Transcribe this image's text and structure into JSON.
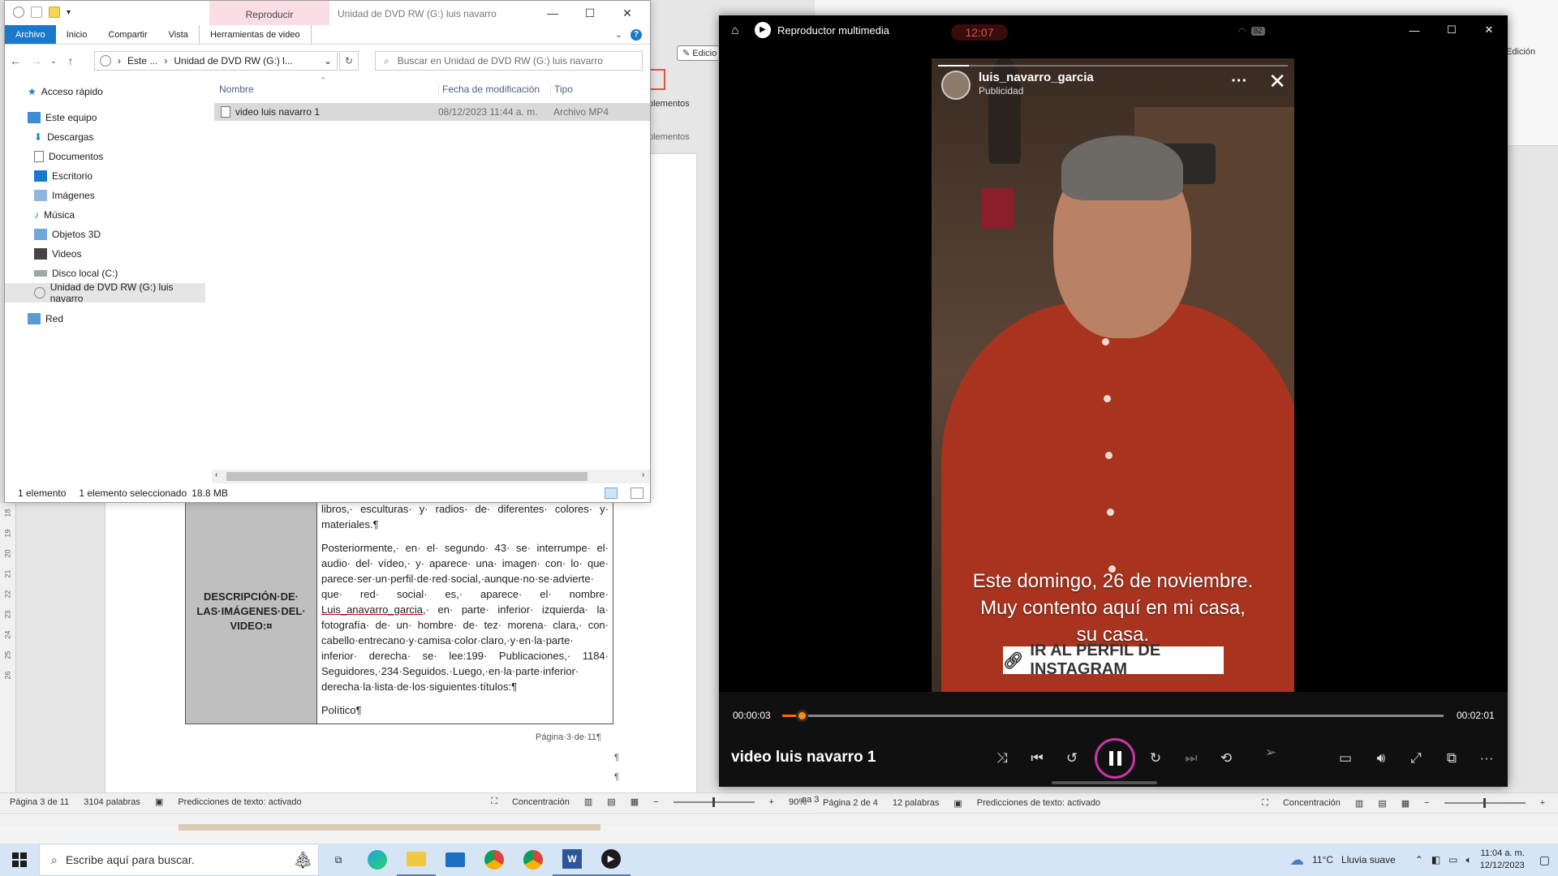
{
  "word_left": {
    "ruler_marks": [
      "18",
      "19",
      "20",
      "21",
      "22",
      "23",
      "24",
      "25",
      "26"
    ],
    "table_heading": "DESCRIPCIÓN·DE· LAS·IMÁGENES·DEL· VIDEO:¤",
    "para1": "libros,· esculturas· y· radios· de· diferentes· colores· y· materiales.¶",
    "para2_a": "Posteriormente,· en· el· segundo· 43· se· interrumpe· el· audio· del· vídeo,· y· aparece· una· imagen· con· lo· que· parece·ser·un·perfil·de·red·social,·aunque·no·se·advierte· que· red· social· es,· aparece· el· nombre· ",
    "para2_link": "Luis_anavarro_garcia",
    "para2_b": ",· en· parte· inferior· izquierda· la· fotografía· de· un· hombre· de· tez· morena· clara,· con· cabello·entrecano·y·camisa·color·claro,·y·en·la·parte· inferior· derecha· se· lee:199· Publicaciones,· 1184· Seguidores,·234·Seguidos.·Luego,·en·la·parte·inferior· derecha·la·lista·de·los·siguientes·títulos:¶",
    "para3": "Político¶",
    "page_label": "Página·3·de·11¶",
    "pilcrow": "¶",
    "status": {
      "page": "Página 3 de 11",
      "words": "3104 palabras",
      "predict": "Predicciones de texto: activado",
      "focus": "Concentración",
      "zoom": "90%"
    }
  },
  "word_right": {
    "ribbon_edit": "Edición",
    "ribbon_edit2": "Edicio",
    "ribbon_complementos": "plementos",
    "ribbon_complementos2": "plementos",
    "status": {
      "page": "Página 2 de 4",
      "words": "12 palabras",
      "predict": "Predicciones de texto: activado",
      "focus": "Concentración",
      "cut": "na 3"
    }
  },
  "explorer": {
    "context_tab": "Reproducir",
    "window_title": "Unidad de DVD RW (G:) luis navarro",
    "tabs": [
      "Archivo",
      "Inicio",
      "Compartir",
      "Vista",
      "Herramientas de video"
    ],
    "address_parts": [
      "Este ...",
      "Unidad de DVD RW (G:) l..."
    ],
    "search_placeholder": "Buscar en Unidad de DVD RW (G:) luis navarro",
    "nav": {
      "quick": "Acceso rápido",
      "pc": "Este equipo",
      "items": [
        "Descargas",
        "Documentos",
        "Escritorio",
        "Imágenes",
        "Música",
        "Objetos 3D",
        "Videos",
        "Disco local (C:)",
        "Unidad de DVD RW (G:) luis navarro"
      ],
      "network": "Red"
    },
    "columns": {
      "name": "Nombre",
      "date": "Fecha de modificación",
      "type": "Tipo"
    },
    "file": {
      "name": "video luis navarro 1",
      "date": "08/12/2023 11:44 a. m.",
      "type": "Archivo MP4"
    },
    "status": {
      "count": "1 elemento",
      "selected": "1 elemento seleccionado",
      "size": "18.8 MB"
    }
  },
  "player": {
    "app_title": "Reproductor multimedia",
    "clock_overlay": "12:07",
    "battery": "82",
    "ig_user": "luis_navarro_garcia",
    "ig_sub": "Publicidad",
    "caption": [
      "Este domingo, 26 de noviembre.",
      "Muy contento aquí en mi casa,",
      "su casa."
    ],
    "ig_button": "IR AL PERFIL DE INSTAGRAM",
    "time_current": "00:00:03",
    "time_total": "00:02:01",
    "title": "video luis navarro 1",
    "progress_percent": 3
  },
  "taskbar": {
    "search_placeholder": "Escribe aquí para buscar.",
    "weather_temp": "11°C",
    "weather_desc": "Lluvia suave",
    "time": "11:04 a. m.",
    "date": "12/12/2023"
  },
  "colors": {
    "accent": "#1979ca",
    "player_progress": "#ff6a00",
    "play_ring": "#c837ab",
    "context_tab": "#fbdde6"
  }
}
